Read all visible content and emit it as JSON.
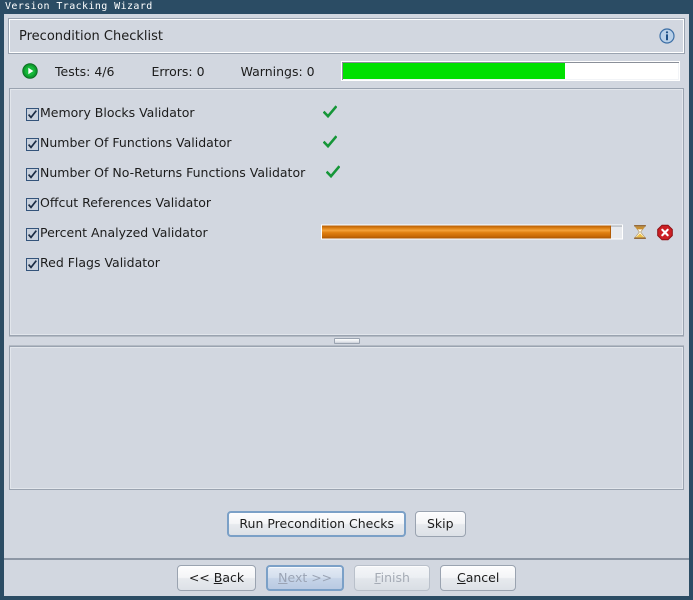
{
  "window": {
    "title": "Version Tracking Wizard"
  },
  "header": {
    "title": "Precondition Checklist",
    "info_icon": "info-icon"
  },
  "status": {
    "run_icon": "play-icon",
    "tests_label": "Tests: 4/6",
    "errors_label": "Errors: 0",
    "warnings_label": "Warnings: 0",
    "overall_progress_percent": 66
  },
  "validators": [
    {
      "label": "Memory Blocks Validator",
      "checked": true,
      "state": "passed",
      "status_icon": "green-check-icon"
    },
    {
      "label": "Number Of Functions Validator",
      "checked": true,
      "state": "passed",
      "status_icon": "green-check-icon"
    },
    {
      "label": "Number Of No-Returns Functions Validator",
      "checked": true,
      "state": "passed",
      "status_icon": "green-check-icon"
    },
    {
      "label": "Offcut References Validator",
      "checked": true,
      "state": "pending",
      "status_icon": ""
    },
    {
      "label": "Percent Analyzed Validator",
      "checked": true,
      "state": "running",
      "status_icon": "hourglass-icon",
      "progress_percent": 96,
      "cancel_icon": "stop-cancel-icon"
    },
    {
      "label": "Red Flags Validator",
      "checked": true,
      "state": "pending",
      "status_icon": ""
    }
  ],
  "actions": {
    "run_label": "Run Precondition Checks",
    "skip_label": "Skip"
  },
  "nav": {
    "back_label": "<< Back",
    "next_label": "Next >>",
    "finish_label": "Finish",
    "cancel_label": "Cancel"
  },
  "colors": {
    "titlebar": "#2b4c64",
    "panel_bg": "#d2d7e0",
    "progress_green": "#00e000",
    "progress_orange": "#d97b10",
    "check_green": "#159638",
    "cancel_red": "#cc1f24"
  }
}
